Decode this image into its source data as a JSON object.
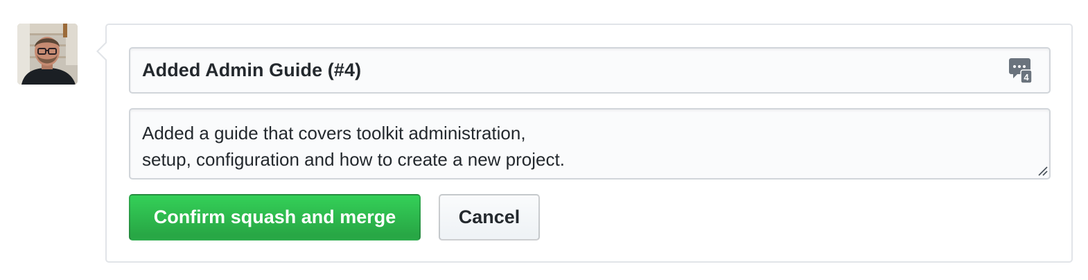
{
  "commit_form": {
    "title_value": "Added Admin Guide (#4)",
    "message_lines": [
      "Added a guide that covers toolkit administration,",
      "setup, configuration and how to create a new project."
    ],
    "reference_badge_count": "4"
  },
  "actions": {
    "confirm_label": "Confirm squash and merge",
    "cancel_label": "Cancel"
  },
  "icons": {
    "avatar": "user-avatar",
    "reference": "saved-replies-icon",
    "resize": "resize-grip-icon"
  },
  "colors": {
    "primary_button": "#2cbe4e",
    "primary_button_text": "#ffffff",
    "border": "#d1d5da",
    "input_bg": "#fafbfc"
  }
}
